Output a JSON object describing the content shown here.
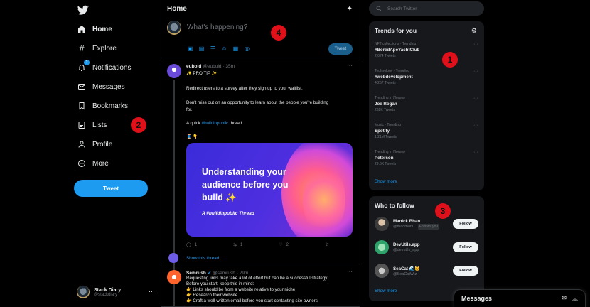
{
  "nav": {
    "items": [
      {
        "label": "Home",
        "icon": "home-icon"
      },
      {
        "label": "Explore",
        "icon": "hashtag-icon"
      },
      {
        "label": "Notifications",
        "icon": "bell-icon",
        "badge": "1"
      },
      {
        "label": "Messages",
        "icon": "envelope-icon"
      },
      {
        "label": "Bookmarks",
        "icon": "bookmark-icon"
      },
      {
        "label": "Lists",
        "icon": "list-icon"
      },
      {
        "label": "Profile",
        "icon": "person-icon"
      },
      {
        "label": "More",
        "icon": "more-circle-icon"
      }
    ],
    "tweet_button": "Tweet",
    "profile": {
      "name": "Stack Diary",
      "handle": "@stackdiary"
    }
  },
  "markers": [
    "1",
    "2",
    "3",
    "4"
  ],
  "feed": {
    "title": "Home",
    "composer_placeholder": "What's happening?",
    "composer_tweet": "Tweet",
    "post1": {
      "name": "euboid",
      "handle": "@euboid",
      "time": "· 35m",
      "line1": "✨ PRO TIP ✨",
      "line2": "Redirect users to a survey after they sign up to your waitlist.",
      "line3a": "Don't miss out on an opportunity to learn about the people you're building",
      "line3b": "for.",
      "line4_prefix": "A quick ",
      "line4_link": "#buildinpublic",
      "line4_suffix": " thread",
      "emoji": "🧵 👇",
      "card_title": "Understanding your audience before you build ✨",
      "card_sub": "A #buildinpublic Thread",
      "replies": "1",
      "retweets": "1",
      "likes": "2",
      "show_thread": "Show this thread"
    },
    "post2": {
      "name": "Semrush",
      "handle": "@semrush",
      "time": "· 29m",
      "lines": [
        "Requesting links may take a lot of effort but can be a successful strategy.",
        "Before you start, keep this in mind:",
        "👉 Links should be from a website relative to your niche",
        "👉 Research their website",
        "👉 Craft a well-written email before you start contacting site owners"
      ]
    }
  },
  "search": {
    "placeholder": "Search Twitter"
  },
  "trends": {
    "title": "Trends for you",
    "items": [
      {
        "meta": "NFT collections · Trending",
        "name": "#BoredApeYachtClub",
        "count": "2,674 Tweets"
      },
      {
        "meta": "Technology · Trending",
        "name": "#webdevelopment",
        "count": "4,257 Tweets"
      },
      {
        "meta": "Trending in Norway",
        "name": "Joe Rogan",
        "count": "262K Tweets"
      },
      {
        "meta": "Music · Trending",
        "name": "Spotify",
        "count": "1.21M Tweets"
      },
      {
        "meta": "Trending in Norway",
        "name": "Peterson",
        "count": "29.6K Tweets"
      }
    ],
    "show_more": "Show more"
  },
  "who_to_follow": {
    "title": "Who to follow",
    "items": [
      {
        "name": "Manick Bhan",
        "handle": "@madmani...",
        "follows_you": "Follows you",
        "button": "Follow"
      },
      {
        "name": "DevUtils.app",
        "handle": "@devutils_app",
        "button": "Follow"
      },
      {
        "name": "SeaCat 🌊🐱",
        "handle": "@SeaCatWiz",
        "button": "Follow"
      }
    ],
    "show_more": "Show more"
  },
  "messages_drawer": {
    "title": "Messages"
  },
  "colors": {
    "accent": "#1d9bf0",
    "marker": "#e0101a",
    "panel": "#16181c"
  }
}
